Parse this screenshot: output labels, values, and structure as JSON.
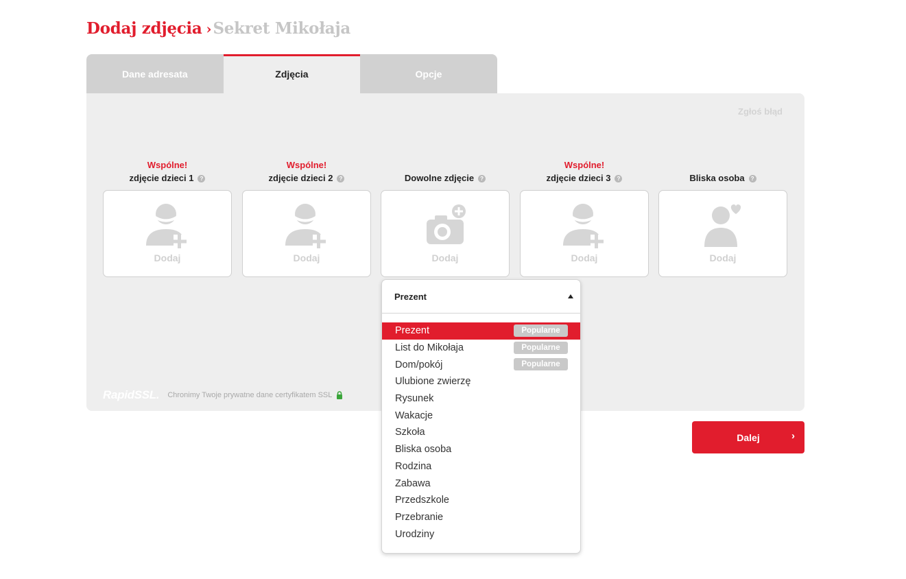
{
  "header": {
    "title": "Dodaj zdjęcia",
    "separator": "›",
    "subtitle": "Sekret Mikołaja"
  },
  "tabs": [
    {
      "label": "Dane adresata",
      "active": false
    },
    {
      "label": "Zdjęcia",
      "active": true
    },
    {
      "label": "Opcje",
      "active": false
    }
  ],
  "panel": {
    "report_link": "Zgłoś błąd"
  },
  "slots": [
    {
      "badge": "Wspólne!",
      "label": "zdjęcie dzieci 1",
      "help": "?",
      "icon": "person-add-icon",
      "add_label": "Dodaj"
    },
    {
      "badge": "Wspólne!",
      "label": "zdjęcie dzieci 2",
      "help": "?",
      "icon": "person-add-icon",
      "add_label": "Dodaj"
    },
    {
      "badge": "",
      "label": "Dowolne zdjęcie",
      "help": "?",
      "icon": "camera-add-icon",
      "add_label": "Dodaj"
    },
    {
      "badge": "Wspólne!",
      "label": "zdjęcie dzieci 3",
      "help": "?",
      "icon": "person-add-icon",
      "add_label": "Dodaj"
    },
    {
      "badge": "",
      "label": "Bliska osoba",
      "help": "?",
      "icon": "person-heart-icon",
      "add_label": "Dodaj"
    }
  ],
  "ssl": {
    "logo": "RapidSSL.",
    "text": "Chronimy Twoje prywatne dane certyfikatem SSL"
  },
  "next_button": {
    "label": "Dalej",
    "chevron": "›"
  },
  "dropdown": {
    "selected": "Prezent",
    "options": [
      {
        "label": "Prezent",
        "badge": "Popularne",
        "selected": true
      },
      {
        "label": "List do Mikołaja",
        "badge": "Popularne",
        "selected": false
      },
      {
        "label": "Dom/pokój",
        "badge": "Popularne",
        "selected": false
      },
      {
        "label": "Ulubione zwierzę",
        "badge": "",
        "selected": false
      },
      {
        "label": "Rysunek",
        "badge": "",
        "selected": false
      },
      {
        "label": "Wakacje",
        "badge": "",
        "selected": false
      },
      {
        "label": "Szkoła",
        "badge": "",
        "selected": false
      },
      {
        "label": "Bliska osoba",
        "badge": "",
        "selected": false
      },
      {
        "label": "Rodzina",
        "badge": "",
        "selected": false
      },
      {
        "label": "Zabawa",
        "badge": "",
        "selected": false
      },
      {
        "label": "Przedszkole",
        "badge": "",
        "selected": false
      },
      {
        "label": "Przebranie",
        "badge": "",
        "selected": false
      },
      {
        "label": "Urodziny",
        "badge": "",
        "selected": false
      }
    ]
  },
  "colors": {
    "accent": "#e11d2d",
    "panel_bg": "#eeeeee",
    "tab_bg": "#d1d1d1",
    "badge_bg": "#c9c9c9",
    "lock_green": "#3aa53a"
  }
}
